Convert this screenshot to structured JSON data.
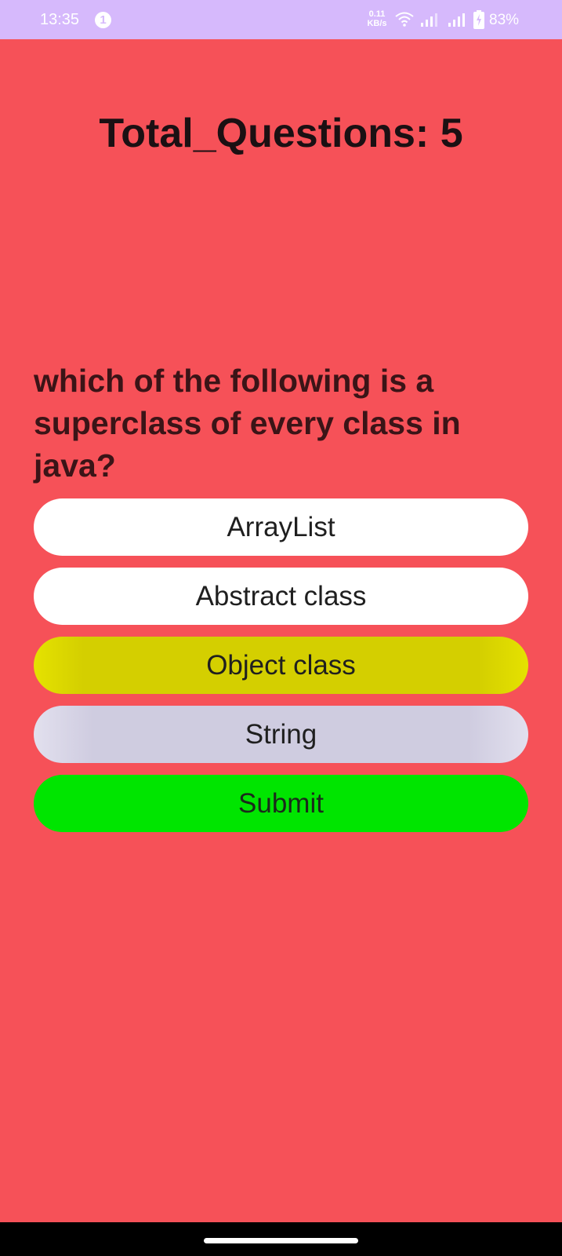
{
  "status_bar": {
    "time": "13:35",
    "notification_count": "1",
    "net_speed_value": "0.11",
    "net_speed_unit": "KB/s",
    "battery_percent": "83%",
    "background_color": "#d6b9fc",
    "icons": [
      "wifi-icon",
      "signal-icon",
      "signal-icon",
      "battery-charging-icon"
    ]
  },
  "quiz": {
    "total_questions_label": "Total_Questions: 5",
    "question": "which of the following is a superclass of every class in java?",
    "options": [
      {
        "label": "ArrayList",
        "color": "#ffffff"
      },
      {
        "label": "Abstract class",
        "color": "#ffffff"
      },
      {
        "label": "Object class",
        "color": "#d4cf00"
      },
      {
        "label": "String",
        "color": "#cfcce0"
      }
    ],
    "submit_label": "Submit",
    "submit_color": "#00e500",
    "background_color": "#f65158"
  }
}
